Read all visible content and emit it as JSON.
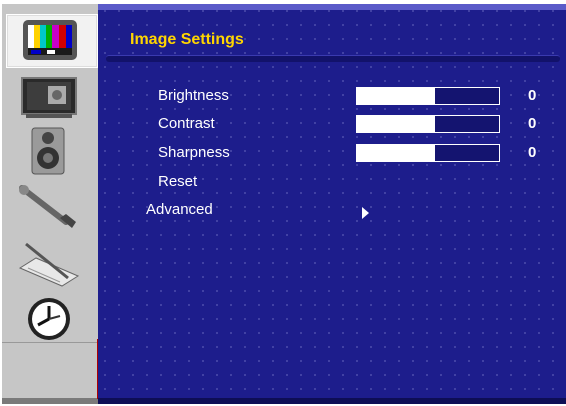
{
  "menu": {
    "title": "Image Settings",
    "items": [
      {
        "label": "Brightness",
        "value": "0",
        "level": 0.55
      },
      {
        "label": "Contrast",
        "value": "0",
        "level": 0.55
      },
      {
        "label": "Sharpness",
        "value": "0",
        "level": 0.55
      },
      {
        "label": "Reset"
      },
      {
        "label": "Advanced"
      }
    ]
  },
  "sidebar": {
    "icons": [
      "tv-color-bars-icon",
      "monitor-picture-icon",
      "speaker-icon",
      "wrench-icon",
      "pen-paper-icon",
      "clock-icon"
    ],
    "active": 0
  },
  "colors": {
    "background": "#1d1d8c",
    "title": "#ffd500",
    "text": "#ffffff",
    "sidebar": "#c6c6c6"
  }
}
